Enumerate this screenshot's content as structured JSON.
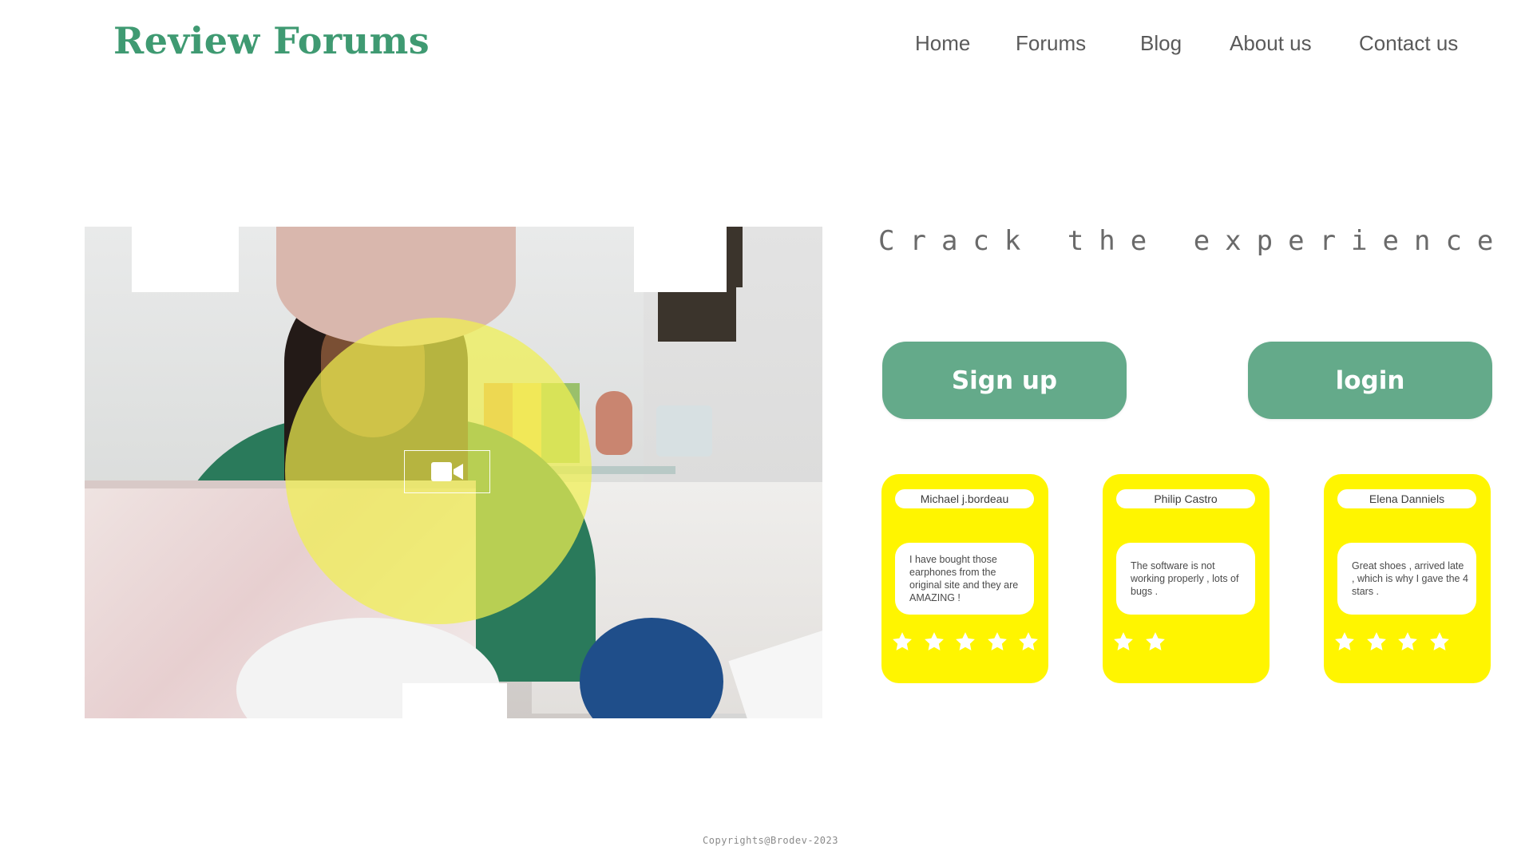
{
  "header": {
    "logo": "Review Forums",
    "nav": [
      {
        "label": "Home"
      },
      {
        "label": "Forums"
      },
      {
        "label": "Blog"
      },
      {
        "label": "About us"
      },
      {
        "label": "Contact us"
      }
    ]
  },
  "hero": {
    "overlay_color": "#f0f050",
    "video_icon": "video-camera-icon"
  },
  "main": {
    "tagline": "Crack the experience",
    "signup_label": "Sign up",
    "login_label": "login"
  },
  "reviews": [
    {
      "name": "Michael j.bordeau",
      "text": "I have bought those earphones from the original site and they are AMAZING !",
      "stars": 5
    },
    {
      "name": "Philip Castro",
      "text": "The software is not working properly , lots of bugs .",
      "stars": 2
    },
    {
      "name": "Elena Danniels",
      "text": "Great shoes , arrived late , which is why I gave the 4 stars .",
      "stars": 4
    }
  ],
  "footer": {
    "copyright": "Copyrights@Brodev-2023"
  },
  "colors": {
    "brand_green": "#3f9a72",
    "button_green": "#64aa8a",
    "card_yellow": "#fff500",
    "star_white": "#ffffff"
  }
}
